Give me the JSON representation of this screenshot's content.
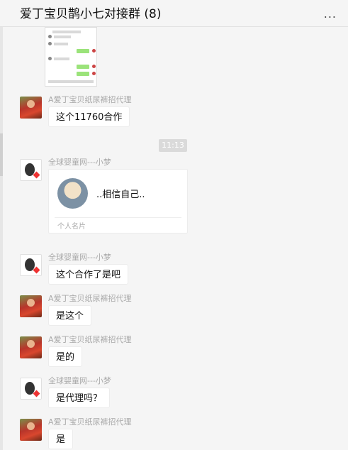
{
  "header": {
    "title": "爱丁宝贝鹊小七对接群 (8)",
    "more_glyph": "..."
  },
  "colors": {
    "bubble": "#ffffff",
    "background": "#f5f5f5",
    "sender": "#a9a9a9",
    "time_badge": "#dadada"
  },
  "chat": {
    "time_label": "11:13",
    "card": {
      "name": "..相信自己..",
      "footer": "个人名片"
    },
    "messages": [
      {
        "sender": "A爱丁宝贝纸尿裤招代理",
        "text": "这个11760合作"
      },
      {
        "sender": "全球婴童网---小梦",
        "text": "这个合作了是吧"
      },
      {
        "sender": "A爱丁宝贝纸尿裤招代理",
        "text": "是这个"
      },
      {
        "sender": "A爱丁宝贝纸尿裤招代理",
        "text": "是的"
      },
      {
        "sender": "全球婴童网---小梦",
        "text": "是代理吗？"
      },
      {
        "sender": "A爱丁宝贝纸尿裤招代理",
        "text": "是"
      }
    ],
    "card_sender": "全球婴童网---小梦"
  }
}
